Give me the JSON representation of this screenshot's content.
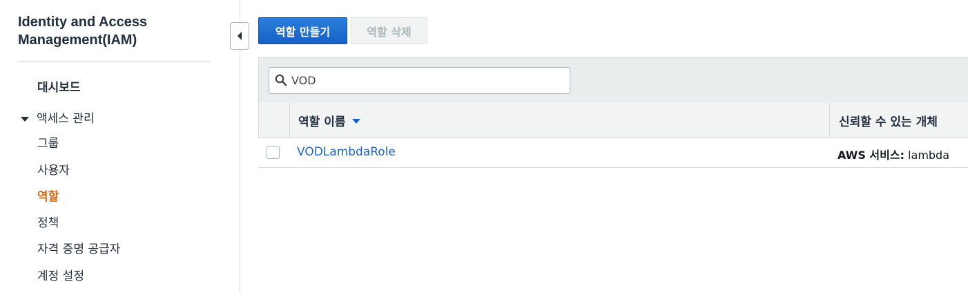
{
  "sidebar": {
    "title": "Identity and Access Management(IAM)",
    "dashboard": "대시보드",
    "access_management": "액세스 관리",
    "items": [
      {
        "label": "그룹"
      },
      {
        "label": "사용자"
      },
      {
        "label": "역할",
        "active": true
      },
      {
        "label": "정책"
      },
      {
        "label": "자격 증명 공급자"
      },
      {
        "label": "계정 설정"
      }
    ]
  },
  "toolbar": {
    "create_role": "역할 만들기",
    "delete_role": "역할 삭제"
  },
  "search": {
    "value": "VOD"
  },
  "table": {
    "columns": {
      "role_name": "역할 이름",
      "trusted_entity": "신뢰할 수 있는 개체"
    },
    "rows": [
      {
        "role_name": "VODLambdaRole",
        "trusted_entity_prefix": "AWS 서비스:",
        "trusted_entity_value": "lambda"
      }
    ]
  },
  "colors": {
    "primary_button": "#1e72d3",
    "link": "#1f66c1",
    "active_nav": "#dd6b10"
  }
}
